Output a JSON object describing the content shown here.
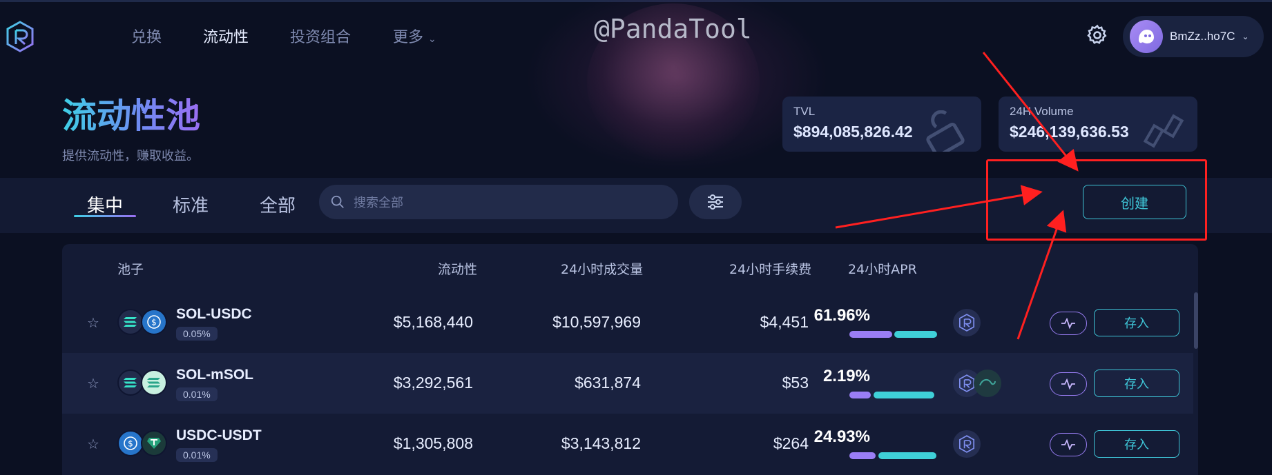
{
  "nav": {
    "items": [
      "兑换",
      "流动性",
      "投资组合",
      "更多"
    ],
    "active": "流动性",
    "more_chevron": "⌄"
  },
  "watermark": "@PandaTool",
  "wallet": {
    "label": "BmZz..ho7C"
  },
  "header": {
    "title": "流动性池",
    "subtitle": "提供流动性，赚取收益。"
  },
  "stats": {
    "tvl": {
      "label": "TVL",
      "value": "$894,085,826.42"
    },
    "volume": {
      "label": "24H Volume",
      "value": "$246,139,636.53"
    }
  },
  "tabs": [
    "集中",
    "标准",
    "全部"
  ],
  "active_tab": "集中",
  "search": {
    "placeholder": "搜索全部"
  },
  "create_label": "创建",
  "table": {
    "columns": [
      "池子",
      "流动性",
      "24小时成交量",
      "24小时手续费",
      "24小时APR"
    ],
    "rows": [
      {
        "pair": "SOL-USDC",
        "fee": "0.05%",
        "liquidity": "$5,168,440",
        "volume": "$10,597,969",
        "fees": "$4,451",
        "apr": "61.96%",
        "apr_split": [
          0.49,
          0.51
        ],
        "deposit": "存入"
      },
      {
        "pair": "SOL-mSOL",
        "fee": "0.01%",
        "liquidity": "$3,292,561",
        "volume": "$631,874",
        "fees": "$53",
        "apr": "2.19%",
        "apr_split": [
          0.25,
          0.75
        ],
        "deposit": "存入"
      },
      {
        "pair": "USDC-USDT",
        "fee": "0.01%",
        "liquidity": "$1,305,808",
        "volume": "$3,143,812",
        "fees": "$264",
        "apr": "24.93%",
        "apr_split": [
          0.3,
          0.7
        ],
        "deposit": "存入"
      }
    ]
  },
  "colors": {
    "accent_teal": "#3fc6d8",
    "accent_purple": "#9a7ef5",
    "annotation_red": "#ff2020",
    "background": "#0b1022"
  }
}
